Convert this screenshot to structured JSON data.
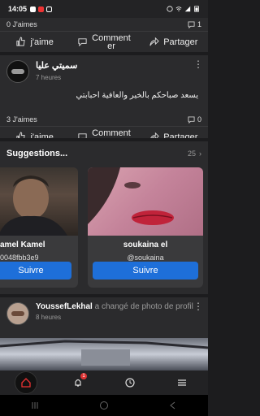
{
  "status_bar": {
    "time": "14:05",
    "battery": "88"
  },
  "post1": {
    "likes": "0 J'aimes",
    "comments": "1"
  },
  "actions": {
    "like": "j'aime",
    "comment": "Comment\ner",
    "share": "Partager"
  },
  "post2": {
    "author": "سميتي عليا",
    "time": "7 heures",
    "text": "يسعد صباحكم بالخير والعافية احبابتي",
    "likes": "3 J'aimes",
    "comments": "0"
  },
  "suggestions": {
    "title": "Suggestions...",
    "count": "25",
    "cards": [
      {
        "name": "amel Kamel",
        "handle": "0048fbb3e9",
        "button": "Suivre"
      },
      {
        "name": "soukaina el",
        "handle": "@soukaina",
        "button": "Suivre"
      }
    ]
  },
  "post3": {
    "author": "YoussefLekhal",
    "activity": "a changé de photo de profil",
    "time": "8 heures"
  },
  "bottom_nav": {
    "notif_badge": "1"
  }
}
